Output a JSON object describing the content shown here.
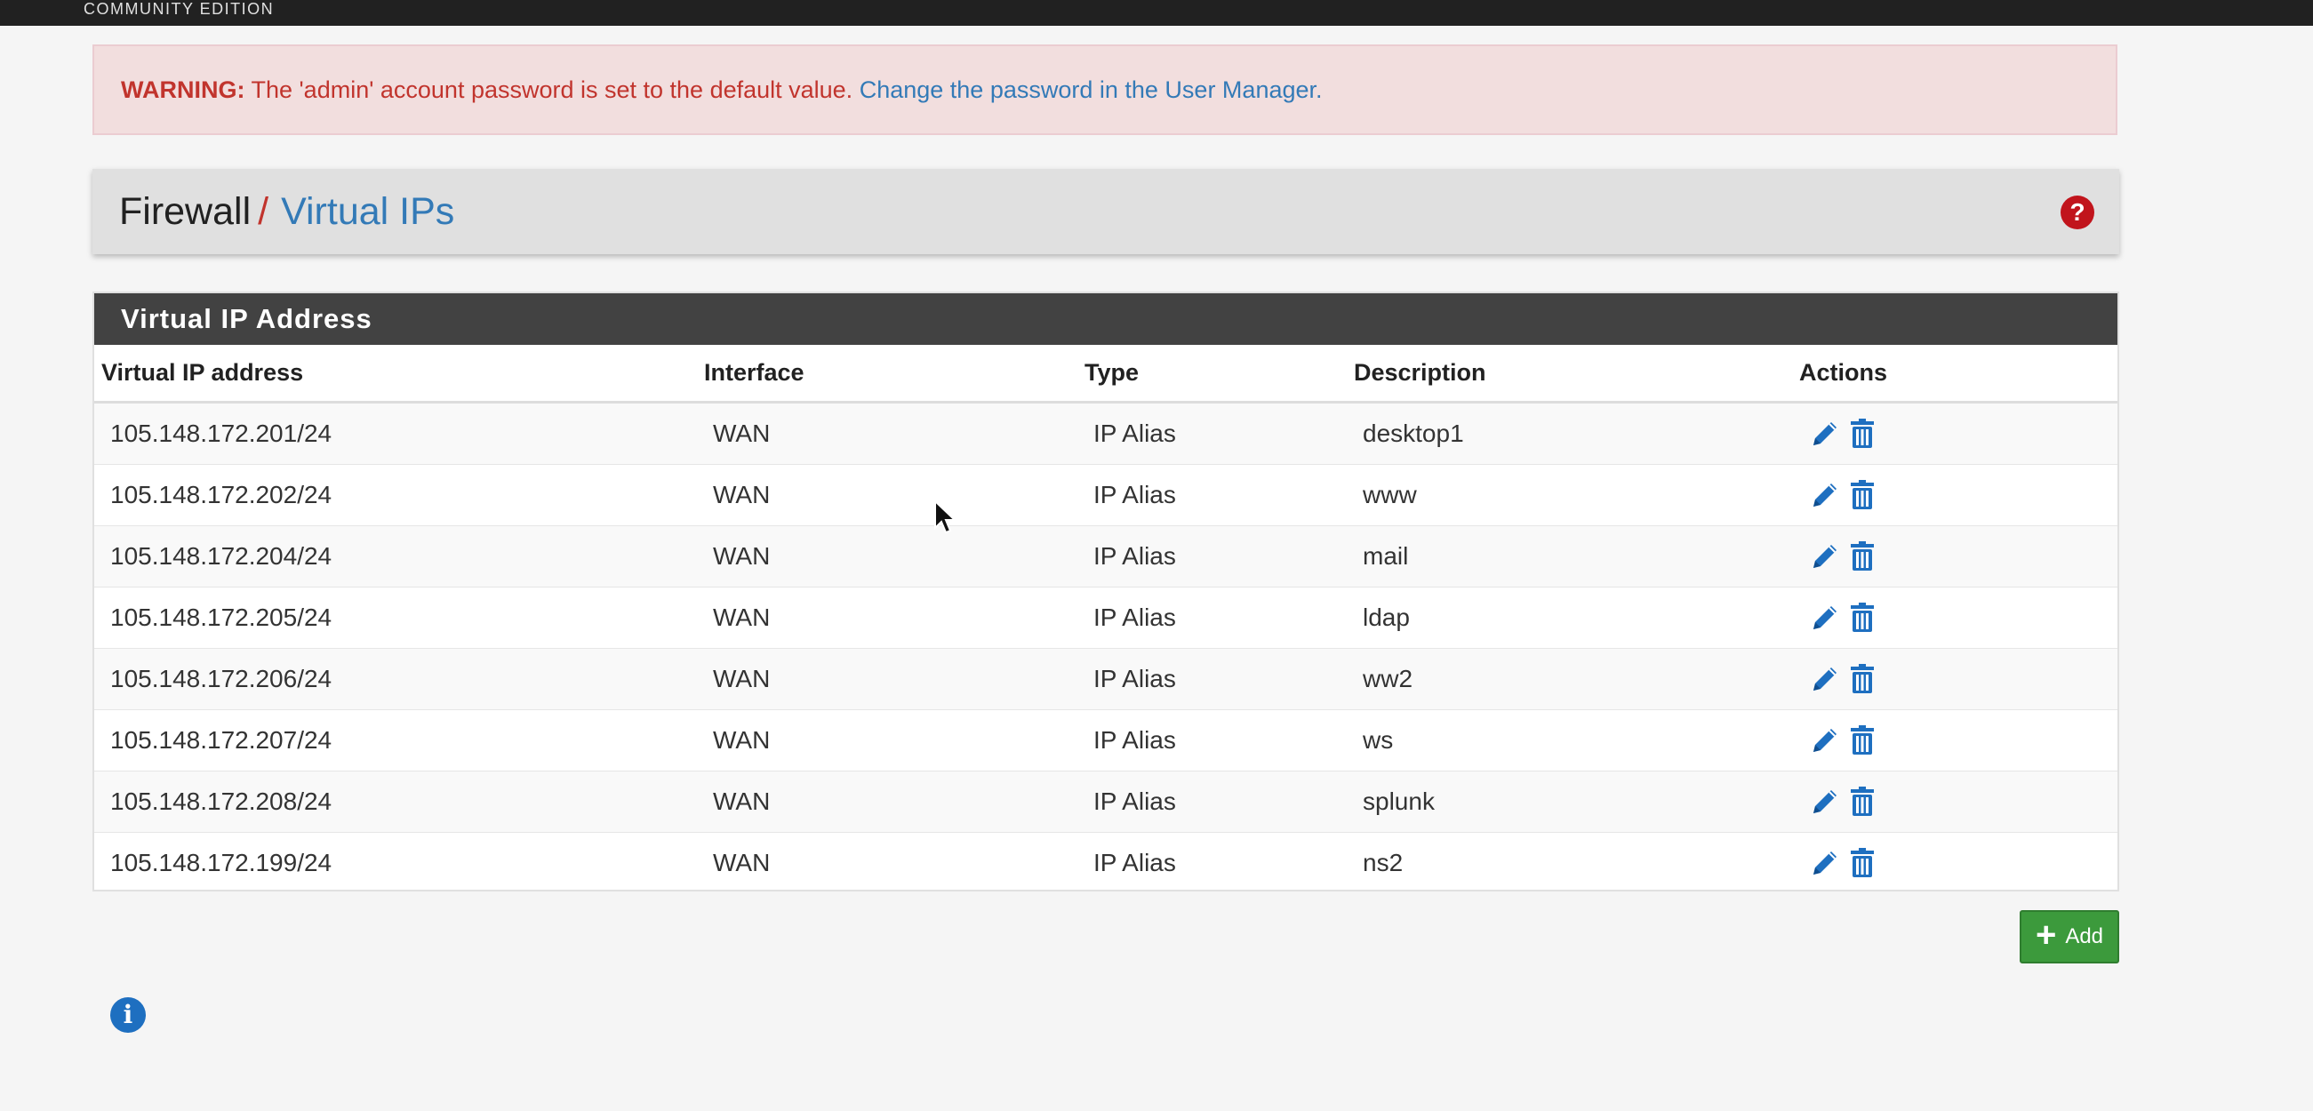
{
  "topbar": {
    "edition": "COMMUNITY EDITION"
  },
  "warning": {
    "label": "WARNING:",
    "message": "The 'admin' account password is set to the default value.",
    "link_text": "Change the password in the User Manager."
  },
  "breadcrumb": {
    "section": "Firewall",
    "separator": "/",
    "page": "Virtual IPs"
  },
  "panel": {
    "title": "Virtual IP Address",
    "columns": [
      "Virtual IP address",
      "Interface",
      "Type",
      "Description",
      "Actions"
    ],
    "rows": [
      {
        "ip": "105.148.172.201/24",
        "interface": "WAN",
        "type": "IP Alias",
        "description": "desktop1"
      },
      {
        "ip": "105.148.172.202/24",
        "interface": "WAN",
        "type": "IP Alias",
        "description": "www"
      },
      {
        "ip": "105.148.172.204/24",
        "interface": "WAN",
        "type": "IP Alias",
        "description": "mail"
      },
      {
        "ip": "105.148.172.205/24",
        "interface": "WAN",
        "type": "IP Alias",
        "description": "ldap"
      },
      {
        "ip": "105.148.172.206/24",
        "interface": "WAN",
        "type": "IP Alias",
        "description": "ww2"
      },
      {
        "ip": "105.148.172.207/24",
        "interface": "WAN",
        "type": "IP Alias",
        "description": "ws"
      },
      {
        "ip": "105.148.172.208/24",
        "interface": "WAN",
        "type": "IP Alias",
        "description": "splunk"
      },
      {
        "ip": "105.148.172.199/24",
        "interface": "WAN",
        "type": "IP Alias",
        "description": "ns2"
      }
    ]
  },
  "add_button": {
    "label": "Add"
  },
  "icons": {
    "help": "question-circle-icon",
    "info": "info-circle-icon",
    "edit": "pencil-icon",
    "delete": "trash-icon",
    "add": "plus-icon"
  },
  "colors": {
    "accent_link": "#337ab7",
    "warning_text": "#c1342d",
    "warning_bg": "#f2dede",
    "panel_heading": "#424242",
    "add_green": "#3c9a3c",
    "icon_blue": "#1e6fc0"
  }
}
